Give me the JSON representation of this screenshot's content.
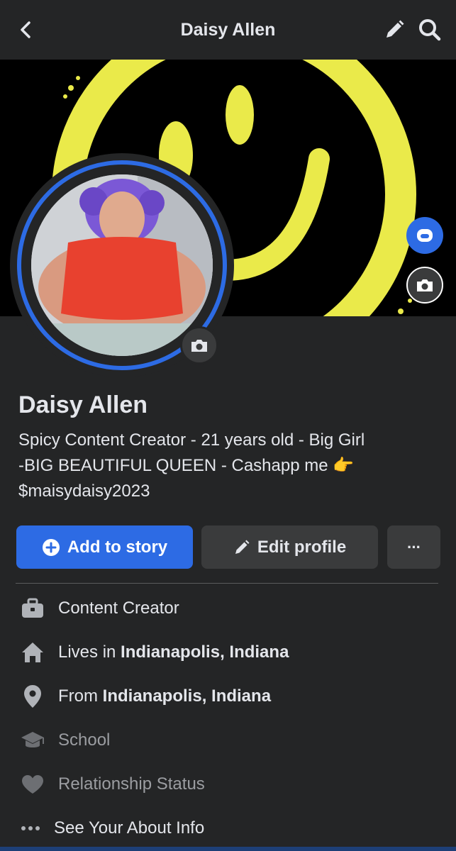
{
  "header": {
    "title": "Daisy Allen",
    "back_icon": "chevron-left-icon",
    "edit_icon": "pencil-icon",
    "search_icon": "search-icon"
  },
  "profile": {
    "name": "Daisy Allen",
    "bio_lines": [
      "Spicy Content Creator - 21 years old - Big Girl",
      "-BIG BEAUTIFUL QUEEN - Cashapp me 👉",
      "$maisydaisy2023"
    ]
  },
  "actions": {
    "add_story": "Add to story",
    "edit_profile": "Edit profile",
    "more": "···"
  },
  "intro": {
    "work": "Content Creator",
    "lives_prefix": "Lives in ",
    "lives_place": "Indianapolis, Indiana",
    "from_prefix": "From ",
    "from_place": "Indianapolis, Indiana",
    "school": "School",
    "relationship": "Relationship Status",
    "see_about": "See Your About Info"
  },
  "colors": {
    "background": "#242526",
    "accent": "#2d6be4",
    "cover_yellow": "#eaea4a",
    "muted_text": "#9b9da1"
  }
}
